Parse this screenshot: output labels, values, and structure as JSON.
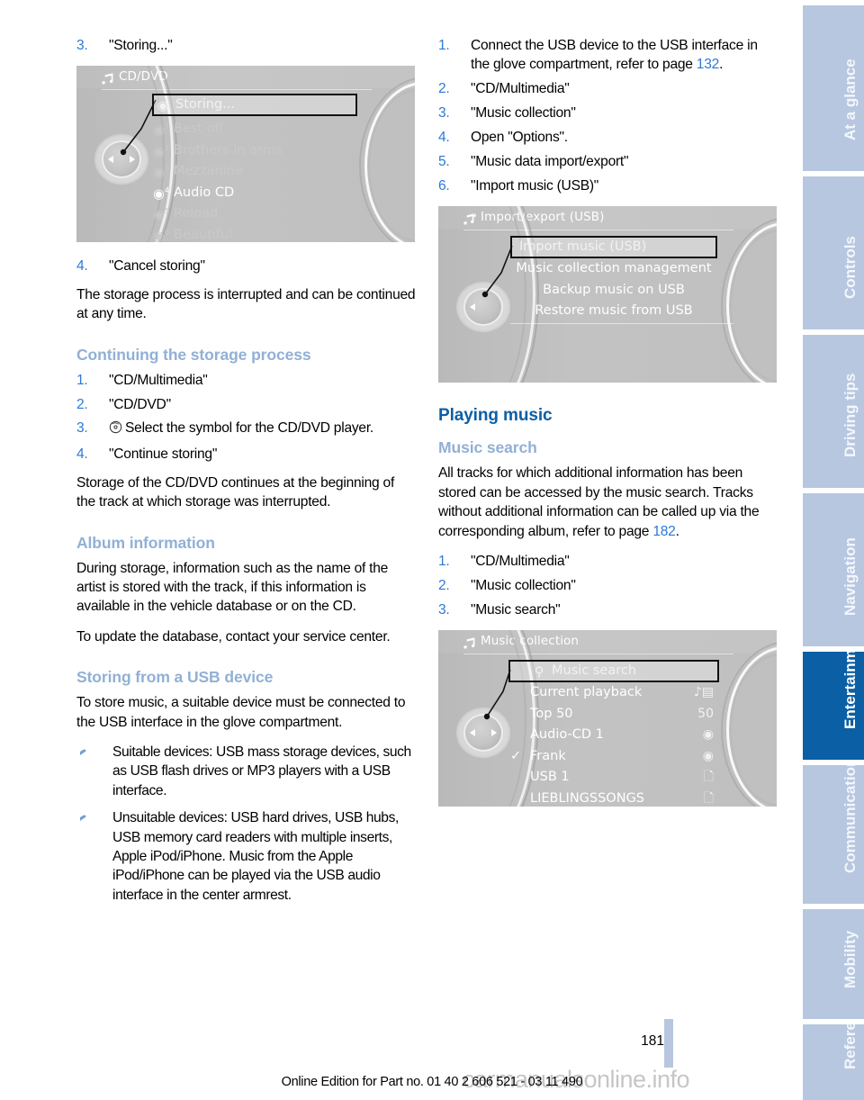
{
  "document": {
    "page_number": "181",
    "edition_line": "Online Edition for Part no. 01 40 2 606 521 - 03 11 490",
    "watermark": "carmanualsonline.info"
  },
  "colors": {
    "heading_primary": "#0b5fa5",
    "heading_secondary": "#91b0d5",
    "link": "#2b7ad6",
    "tab_inactive": "#b7c7e0",
    "tab_active": "#0b5fa5"
  },
  "sidebar": {
    "tabs": [
      {
        "label": "At a glance",
        "active": false
      },
      {
        "label": "Controls",
        "active": false
      },
      {
        "label": "Driving tips",
        "active": false
      },
      {
        "label": "Navigation",
        "active": false
      },
      {
        "label": "Entertainment",
        "active": true
      },
      {
        "label": "Communication",
        "active": false
      },
      {
        "label": "Mobility",
        "active": false
      },
      {
        "label": "Reference",
        "active": false
      }
    ]
  },
  "left_column": {
    "step3": {
      "num": "3.",
      "text": "\"Storing...\""
    },
    "screen_cddvd": {
      "title": "CD/DVD",
      "title_icon": "music-note-icon",
      "rows": [
        {
          "icon": "disc-icon",
          "sup": "",
          "label": "Storing...",
          "state": "selected"
        },
        {
          "icon": "disc-icon",
          "sup": "1",
          "label": "Best off",
          "state": "dim"
        },
        {
          "icon": "disc-icon",
          "sup": "2",
          "label": "Brothers in arms",
          "state": "dim"
        },
        {
          "icon": "disc-icon",
          "sup": "3",
          "label": "Mezzanine",
          "state": "dim"
        },
        {
          "icon": "disc-icon",
          "sup": "4",
          "label": "Audio CD",
          "state": "bright"
        },
        {
          "icon": "disc-icon",
          "sup": "5",
          "label": "Reload",
          "state": "dim"
        },
        {
          "icon": "disc-icon",
          "sup": "6",
          "label": "Beautiful",
          "state": "dim"
        }
      ]
    },
    "step4": {
      "num": "4.",
      "text": "\"Cancel storing\""
    },
    "para_interrupted": "The storage process is interrupted and can be continued at any time.",
    "heading_continuing": "Continuing the storage process",
    "continuing_steps": [
      {
        "num": "1.",
        "text": "\"CD/Multimedia\""
      },
      {
        "num": "2.",
        "text": "\"CD/DVD\""
      },
      {
        "num": "3.",
        "text": "Select the symbol for the CD/DVD player.",
        "icon": "disc-icon"
      },
      {
        "num": "4.",
        "text": "\"Continue storing\""
      }
    ],
    "para_storage_continues": "Storage of the CD/DVD continues at the beginning of the track at which storage was interrupted.",
    "heading_album_info": "Album information",
    "para_album_1": "During storage, information such as the name of the artist is stored with the track, if this information is available in the vehicle database or on the CD.",
    "para_album_2": "To update the database, contact your service center.",
    "heading_storing_usb": "Storing from a USB device",
    "para_usb_intro": "To store music, a suitable device must be connected to the USB interface in the glove compartment.",
    "usb_bullets": [
      "Suitable devices: USB mass storage devices, such as USB flash drives or MP3 players with a USB interface.",
      "Unsuitable devices: USB hard drives, USB hubs, USB memory card readers with multiple inserts, Apple iPod/iPhone. Music from the Apple iPod/iPhone can be played via the USB audio interface in the center armrest."
    ]
  },
  "right_column": {
    "usb_steps": [
      {
        "num": "1.",
        "text_before": "Connect the USB device to the USB interface in the glove compartment, refer to page ",
        "page_ref": "132",
        "text_after": "."
      },
      {
        "num": "2.",
        "text_before": "\"CD/Multimedia\""
      },
      {
        "num": "3.",
        "text_before": "\"Music collection\""
      },
      {
        "num": "4.",
        "text_before": "Open \"Options\"."
      },
      {
        "num": "5.",
        "text_before": "\"Music data import/export\""
      },
      {
        "num": "6.",
        "text_before": "\"Import music (USB)\""
      }
    ],
    "screen_import_export": {
      "title": "Import/export (USB)",
      "title_icon": "music-import-icon",
      "rows": [
        {
          "label": "Import music (USB)",
          "state": "selected"
        },
        {
          "label": "Music collection management",
          "state": "bright"
        },
        {
          "label": "Backup music on USB",
          "state": "bright"
        },
        {
          "label": "Restore music from USB",
          "state": "bright"
        }
      ]
    },
    "heading_playing_music": "Playing music",
    "heading_music_search": "Music search",
    "para_music_search_before": "All tracks for which additional information has been stored can be accessed by the music search. Tracks without additional information can be called up via the corresponding album, refer to page ",
    "para_music_search_ref": "182",
    "para_music_search_after": ".",
    "music_search_steps": [
      {
        "num": "1.",
        "text": "\"CD/Multimedia\""
      },
      {
        "num": "2.",
        "text": "\"Music collection\""
      },
      {
        "num": "3.",
        "text": "\"Music search\""
      }
    ],
    "screen_music_collection": {
      "title": "Music collection",
      "title_icon": "music-note-icon",
      "rows": [
        {
          "label": "Music search",
          "state": "selected",
          "left_icon": "search-icon",
          "right_icon": ""
        },
        {
          "label": "Current playback",
          "state": "bright",
          "left_icon": "",
          "right_icon": "now-playing-icon"
        },
        {
          "label": "Top 50",
          "state": "bright",
          "left_icon": "",
          "right_icon": "50"
        },
        {
          "label": "Audio-CD 1",
          "state": "bright",
          "left_icon": "",
          "right_icon": "disc-icon"
        },
        {
          "label": "Frank",
          "state": "bright",
          "left_icon": "checkmark-icon",
          "right_icon": "disc-icon"
        },
        {
          "label": "USB 1",
          "state": "bright",
          "left_icon": "",
          "right_icon": "folder-icon"
        },
        {
          "label": "LIEBLINGSSONGS",
          "state": "bright",
          "left_icon": "",
          "right_icon": "folder-icon"
        }
      ]
    }
  }
}
